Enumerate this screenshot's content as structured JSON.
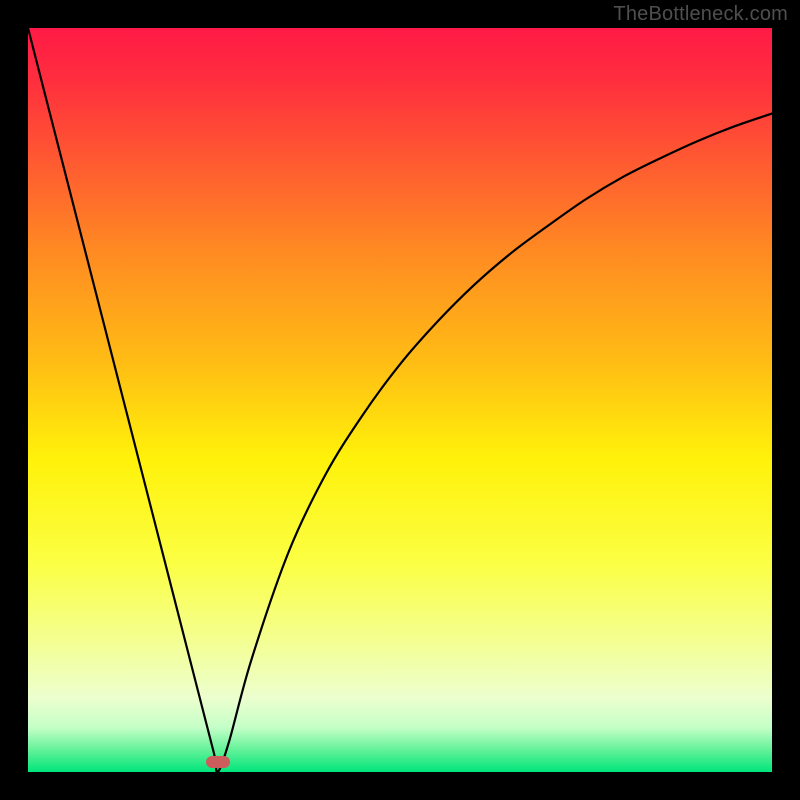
{
  "watermark": "TheBottleneck.com",
  "chart_data": {
    "type": "line",
    "title": "",
    "xlabel": "",
    "ylabel": "",
    "xlim": [
      0,
      1
    ],
    "ylim": [
      0,
      1
    ],
    "note": "V-shaped curve on red-to-green vertical gradient; minimum near x≈0.255, y≈0. Left branch rises steeply to top-left corner; right branch rises with diminishing slope toward upper right. Values are normalized estimates read from pixel positions.",
    "gradient_stops": [
      {
        "pos": 0.0,
        "color": "#ff1a46"
      },
      {
        "pos": 0.07,
        "color": "#ff2e3e"
      },
      {
        "pos": 0.18,
        "color": "#ff5a31"
      },
      {
        "pos": 0.3,
        "color": "#ff8a22"
      },
      {
        "pos": 0.45,
        "color": "#ffbd14"
      },
      {
        "pos": 0.58,
        "color": "#fff20a"
      },
      {
        "pos": 0.72,
        "color": "#fbff44"
      },
      {
        "pos": 0.82,
        "color": "#f4ff8f"
      },
      {
        "pos": 0.9,
        "color": "#ecffce"
      },
      {
        "pos": 0.94,
        "color": "#c5ffc7"
      },
      {
        "pos": 0.97,
        "color": "#64f29a"
      },
      {
        "pos": 1.0,
        "color": "#00e57a"
      }
    ],
    "series": [
      {
        "name": "left-branch",
        "x": [
          0.0,
          0.05,
          0.1,
          0.15,
          0.2,
          0.23,
          0.25,
          0.255
        ],
        "y": [
          1.0,
          0.805,
          0.61,
          0.415,
          0.22,
          0.103,
          0.025,
          0.0
        ]
      },
      {
        "name": "right-branch",
        "x": [
          0.255,
          0.27,
          0.3,
          0.35,
          0.4,
          0.45,
          0.5,
          0.55,
          0.6,
          0.65,
          0.7,
          0.75,
          0.8,
          0.85,
          0.9,
          0.95,
          1.0
        ],
        "y": [
          0.0,
          0.04,
          0.15,
          0.295,
          0.4,
          0.48,
          0.548,
          0.605,
          0.655,
          0.698,
          0.735,
          0.77,
          0.8,
          0.825,
          0.848,
          0.868,
          0.885
        ]
      }
    ],
    "marker": {
      "x": 0.255,
      "y": 0.013,
      "color": "#cd5c5c"
    }
  }
}
